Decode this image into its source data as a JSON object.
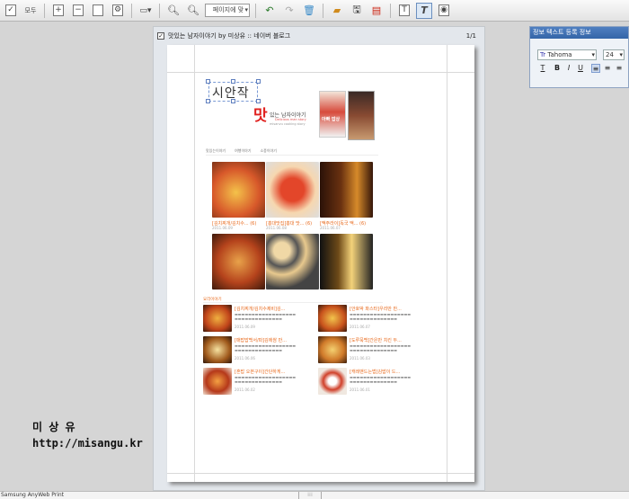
{
  "toolbar": {
    "select_all_label": "모두",
    "zoom_value": "페이지에 맞",
    "items": [
      "zoom-in",
      "zoom-out",
      "undo",
      "redo",
      "open",
      "save",
      "pdf",
      "text-edit",
      "record"
    ]
  },
  "preview": {
    "checkbox_checked": true,
    "document_title": "맛있는 남자이야기 by 미상유 :: 네이버 블로그",
    "page_indicator": "1/1"
  },
  "blog": {
    "start_text": "시안작",
    "logo_big": "맛",
    "logo_text": "있는 남자이야기",
    "logo_sub": "Delicious man story",
    "logo_sub2": "misanvu cooking story",
    "book_text": "아빠 밥상",
    "nav": [
      "맛있는이야기",
      "여행이야기",
      "소풍이야기"
    ],
    "grid_captions": [
      "[김치찌개/김치수... (6)",
      "[홍대맛집]홍대 맛... (6)",
      "[맥주라이]독국 맥... (6)"
    ],
    "grid_dates": [
      "2011.06.09",
      "2011.06.08",
      "2011.06.07"
    ],
    "section_title": "요리이야기",
    "list_left": [
      {
        "title": "[김치찌개/김치수제비]김...",
        "date": "2011.06.09"
      },
      {
        "title": "[매밥밥백서/파]김에쌈 만...",
        "date": "2011.06.06"
      },
      {
        "title": "[혼밥 오븐구이]간단하게...",
        "date": "2011.06.02"
      }
    ],
    "list_right": [
      {
        "title": "[안호박 파스타]우리만 만...",
        "date": "2011.06.07"
      },
      {
        "title": "[도루묵백]간은만 치킨 두...",
        "date": "2011.06.03"
      },
      {
        "title": "[캐레맨드는법]김밥이 드...",
        "date": "2011.06.01"
      }
    ]
  },
  "panel": {
    "title": "정보 텍스트 등록 정보",
    "font_name": "Tahoma",
    "font_size": "24",
    "style_buttons": [
      "T",
      "B",
      "I",
      "U"
    ],
    "align_buttons": [
      "left",
      "center",
      "right"
    ]
  },
  "signature": {
    "name": "미 상 유",
    "url": "http://misangu.kr"
  },
  "status": {
    "app_name": "Samsung AnyWeb Print"
  },
  "colors": {
    "accent": "#e8691c",
    "panel_title": "#3465a8",
    "page": "#ffffff",
    "background": "#d5d5d5"
  }
}
